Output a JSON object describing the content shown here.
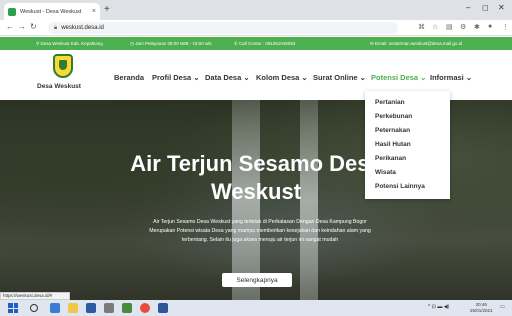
{
  "browser": {
    "tab_title": "Weskust - Desa Weskust",
    "tab_close": "×",
    "new_tab": "+",
    "url": "weskust.desa.id",
    "minimize": "–",
    "maximize": "◻",
    "close": "✕"
  },
  "infobar": {
    "location": "Desa Weskust Kab. Kepahiang",
    "hours": "Jam Pelayanan 08:00 WIB - 15:00 wib",
    "call": "Call Center : 081261049093",
    "email": "Email: sosterman.weskust@desa.mail.go.id"
  },
  "header": {
    "brand": "Desa Weskust",
    "nav": [
      {
        "label": "Beranda"
      },
      {
        "label": "Profil Desa ⌄"
      },
      {
        "label": "Data Desa ⌄"
      },
      {
        "label": "Kolom Desa ⌄"
      },
      {
        "label": "Surat Online ⌄"
      },
      {
        "label": "Potensi Desa ⌄"
      },
      {
        "label": "Informasi ⌄"
      }
    ]
  },
  "dropdown": {
    "items": [
      "Pertanian",
      "Perkebunan",
      "Peternakan",
      "Hasil Hutan",
      "Perikanan",
      "Wisata",
      "Potensi Lainnya"
    ]
  },
  "hero": {
    "title_line1": "Air Terjun Sesamo Desa",
    "title_line2": "Weskust",
    "desc_line1": "Air Terjun Sesamo Desa Weskust yang terletak di Perbatasan Dengan Desa Kampung Bogor",
    "desc_line2": "Merupakan Potensi wisata Desa yang mampu memberikan kesejukan dan keindahan alam yang",
    "desc_line3": "terbentang. Selain itu juga akses menuju air terjun ini sangat mudah",
    "button": "Selengkapnya"
  },
  "status_url": "https://weskust.desa.id/#",
  "taskbar": {
    "tray": "^ ⊡ ▬ ◀)",
    "time": "20:46",
    "date": "25/01/2021"
  },
  "colors": {
    "accent_green": "#4caf50",
    "brand_green": "#2e7d32"
  }
}
